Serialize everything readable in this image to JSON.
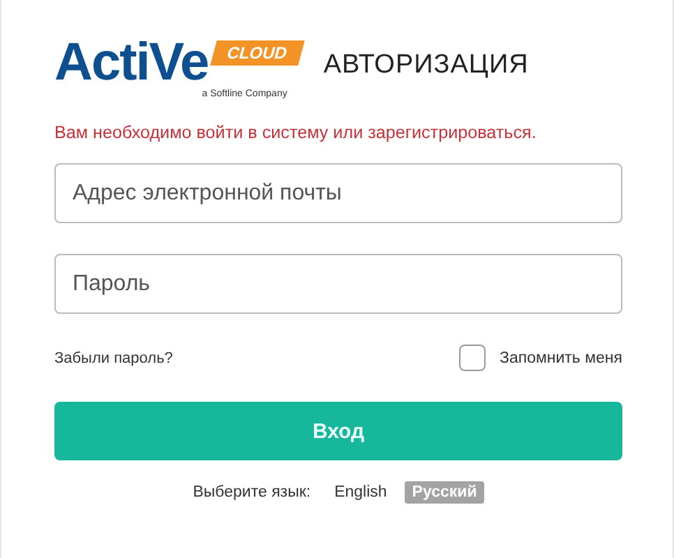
{
  "logo": {
    "word": "ActiVe",
    "badge": "CLOUD",
    "tagline": "a Softline Company"
  },
  "title": "АВТОРИЗАЦИЯ",
  "message": "Вам необходимо войти в систему или зарегистрироваться.",
  "email": {
    "placeholder": "Адрес электронной почты"
  },
  "password": {
    "placeholder": "Пароль"
  },
  "forgot_link": "Забыли пароль?",
  "remember": {
    "label": "Запомнить меня",
    "checked": false
  },
  "submit": "Вход",
  "language": {
    "label": "Выберите язык:",
    "options": [
      {
        "label": "English",
        "selected": false
      },
      {
        "label": "Русский",
        "selected": true
      }
    ]
  }
}
